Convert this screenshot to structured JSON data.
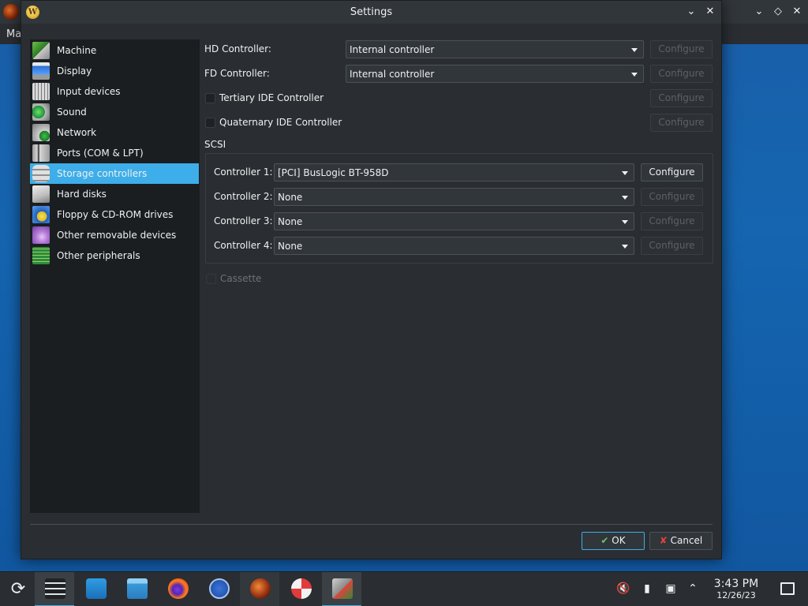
{
  "background_window": {
    "menu_partial": "Ma"
  },
  "dialog": {
    "title": "Settings",
    "sidebar": {
      "selected_index": 6,
      "items": [
        {
          "label": "Machine",
          "icon": "machine-icon"
        },
        {
          "label": "Display",
          "icon": "display-icon"
        },
        {
          "label": "Input devices",
          "icon": "input-devices-icon"
        },
        {
          "label": "Sound",
          "icon": "sound-icon"
        },
        {
          "label": "Network",
          "icon": "network-icon"
        },
        {
          "label": "Ports (COM & LPT)",
          "icon": "ports-icon"
        },
        {
          "label": "Storage controllers",
          "icon": "storage-controllers-icon"
        },
        {
          "label": "Hard disks",
          "icon": "hard-disks-icon"
        },
        {
          "label": "Floppy & CD-ROM drives",
          "icon": "floppy-cdrom-icon"
        },
        {
          "label": "Other removable devices",
          "icon": "removable-devices-icon"
        },
        {
          "label": "Other peripherals",
          "icon": "peripherals-icon"
        }
      ]
    },
    "hd_controller": {
      "label": "HD Controller:",
      "value": "Internal controller",
      "configure_label": "Configure",
      "configure_enabled": false
    },
    "fd_controller": {
      "label": "FD Controller:",
      "value": "Internal controller",
      "configure_label": "Configure",
      "configure_enabled": false
    },
    "tertiary_ide": {
      "label": "Tertiary IDE Controller",
      "checked": false,
      "configure_label": "Configure",
      "configure_enabled": false
    },
    "quaternary_ide": {
      "label": "Quaternary IDE Controller",
      "checked": false,
      "configure_label": "Configure",
      "configure_enabled": false
    },
    "scsi": {
      "group_label": "SCSI",
      "controllers": [
        {
          "label": "Controller 1:",
          "value": "[PCI] BusLogic BT-958D",
          "configure_label": "Configure",
          "configure_enabled": true
        },
        {
          "label": "Controller 2:",
          "value": "None",
          "configure_label": "Configure",
          "configure_enabled": false
        },
        {
          "label": "Controller 3:",
          "value": "None",
          "configure_label": "Configure",
          "configure_enabled": false
        },
        {
          "label": "Controller 4:",
          "value": "None",
          "configure_label": "Configure",
          "configure_enabled": false
        }
      ]
    },
    "cassette": {
      "label": "Cassette",
      "checked": false,
      "enabled": false
    },
    "ok_label": "OK",
    "cancel_label": "Cancel"
  },
  "taskbar": {
    "apps": [
      {
        "name": "application-launcher-icon"
      },
      {
        "name": "system-settings-icon",
        "state": "active"
      },
      {
        "name": "discover-store-icon"
      },
      {
        "name": "file-manager-icon"
      },
      {
        "name": "firefox-icon"
      },
      {
        "name": "network-browser-icon"
      },
      {
        "name": "86box-manager-icon",
        "state": "running"
      },
      {
        "name": "help-lifebuoy-icon"
      },
      {
        "name": "86box-machine-icon",
        "state": "active"
      }
    ],
    "tray": [
      "volume-muted-icon",
      "usb-device-icon",
      "network-wired-icon",
      "tray-expand-icon"
    ],
    "clock_time": "3:43 PM",
    "clock_date": "12/26/23"
  },
  "colors": {
    "accent": "#3daee9",
    "window_bg": "#2a2e32",
    "sidebar_bg": "#1b1e20",
    "desktop": "#1565b0"
  }
}
